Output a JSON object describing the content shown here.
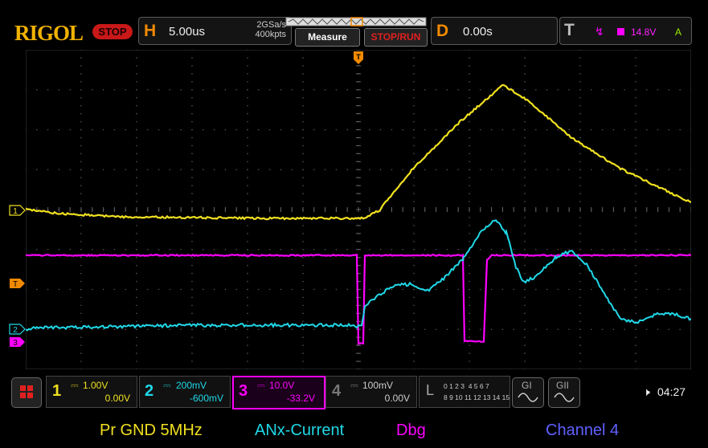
{
  "header": {
    "brand": "RIGOL",
    "run_state": "STOP",
    "horizontal": {
      "letter": "H",
      "value": "5.00us",
      "sample_rate": "2GSa/s",
      "memory_depth": "400kpts"
    },
    "measure_button": "Measure",
    "stop_run_button": "STOP/RUN",
    "delay": {
      "letter": "D",
      "value": "0.00s"
    },
    "trigger": {
      "letter": "T",
      "slope_symbol": "↯",
      "level": "14.8V",
      "mode": "A",
      "color": "#ff00ff"
    }
  },
  "markers": {
    "trigger_position": "T",
    "ch1": "1",
    "trig_level": "T",
    "ch2": "2",
    "ch3": "3"
  },
  "channels": [
    {
      "num": "1",
      "coupling": "⎓",
      "scale": "1.00V",
      "offset": "0.00V",
      "color": "#f0e020",
      "label": "Pr GND 5MHz"
    },
    {
      "num": "2",
      "coupling": "⎓",
      "scale": "200mV",
      "offset": "-600mV",
      "color": "#20d8e8",
      "label": "ANx-Current"
    },
    {
      "num": "3",
      "coupling": "⎓",
      "scale": "10.0V",
      "offset": "-33.2V",
      "color": "#ff00ff",
      "label": "Dbg"
    },
    {
      "num": "4",
      "coupling": "⎓",
      "scale": "100mV",
      "offset": "0.00V",
      "color": "#6060ff",
      "label": "Channel 4"
    }
  ],
  "logic_analyzer": {
    "letter": "L",
    "row1": "0 1 2 3  4 5 6 7",
    "row2": "8 9 10 11 12 13 14 15"
  },
  "generators": [
    "GI",
    "GII"
  ],
  "status": {
    "time": "04:27",
    "speaker_icon": "speaker-icon"
  }
}
